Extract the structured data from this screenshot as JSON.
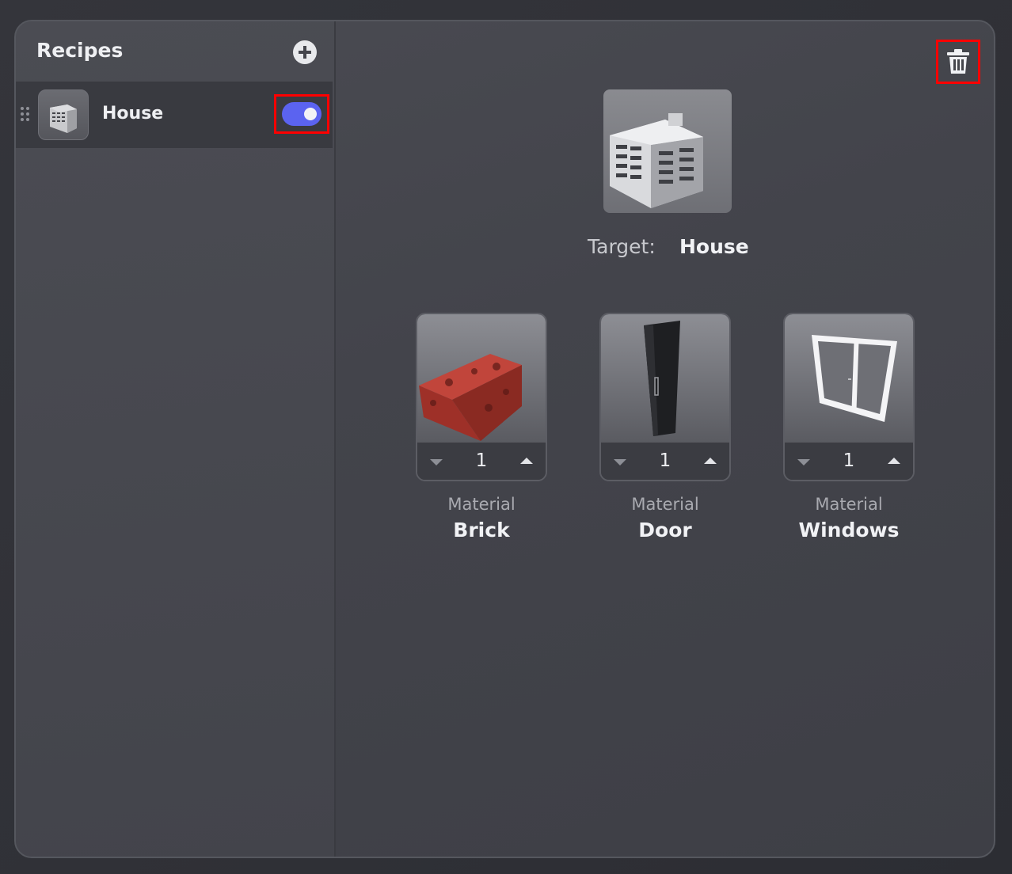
{
  "sidebar": {
    "title": "Recipes",
    "add_icon": "plus-circle-icon",
    "items": [
      {
        "label": "House",
        "icon": "building-icon",
        "enabled": true
      }
    ]
  },
  "detail": {
    "delete_icon": "trash-icon",
    "target_label": "Target:",
    "target_value": "House",
    "materials": [
      {
        "kind": "Material",
        "name": "Brick",
        "quantity": "1"
      },
      {
        "kind": "Material",
        "name": "Door",
        "quantity": "1"
      },
      {
        "kind": "Material",
        "name": "Windows",
        "quantity": "1"
      }
    ]
  },
  "colors": {
    "toggle_on": "#5b63f0",
    "highlight": "#ff0000",
    "brick": "#a8352d"
  }
}
